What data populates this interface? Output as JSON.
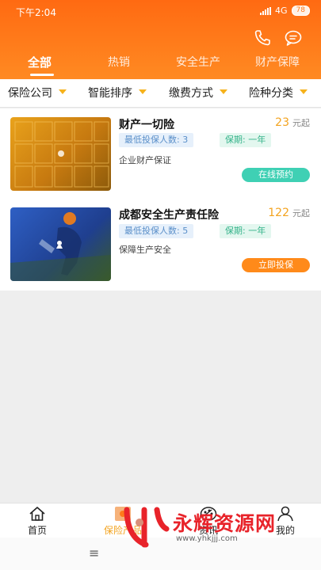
{
  "status_bar": {
    "time": "下午2:04",
    "network": "4G",
    "battery": "78"
  },
  "header": {
    "phone_icon": "phone-icon",
    "message_icon": "message-icon",
    "tabs": [
      {
        "label": "全部",
        "active": true
      },
      {
        "label": "热销",
        "active": false
      },
      {
        "label": "安全生产",
        "active": false
      },
      {
        "label": "财产保障",
        "active": false
      }
    ]
  },
  "filters": [
    {
      "label": "保险公司"
    },
    {
      "label": "智能排序"
    },
    {
      "label": "缴费方式"
    },
    {
      "label": "险种分类"
    }
  ],
  "products": [
    {
      "title": "财产一切险",
      "price": "23",
      "price_unit": "元起",
      "min_insured": "最低投保人数: 3",
      "period": "保期: 一年",
      "description": "企业财产保证",
      "action": "在线预约"
    },
    {
      "title": "成都安全生产责任险",
      "price": "122",
      "price_unit": "元起",
      "min_insured": "最低投保人数: 5",
      "period": "保期: 一年",
      "description": "保障生产安全",
      "action": "立即投保"
    }
  ],
  "bottom_nav": [
    {
      "label": "首页",
      "icon": "home-icon",
      "active": false
    },
    {
      "label": "保险产品",
      "icon": "product-icon",
      "active": true
    },
    {
      "label": "资讯",
      "icon": "news-icon",
      "active": false
    },
    {
      "label": "我的",
      "icon": "user-icon",
      "active": false
    }
  ],
  "watermark": {
    "text": "永辉资源网",
    "url": "www.yhkjjj.com"
  },
  "colors": {
    "header": "#ff7a1a",
    "accent": "#f3a31f",
    "green_button": "#3fd0b4",
    "orange_button": "#ff8a1a"
  }
}
